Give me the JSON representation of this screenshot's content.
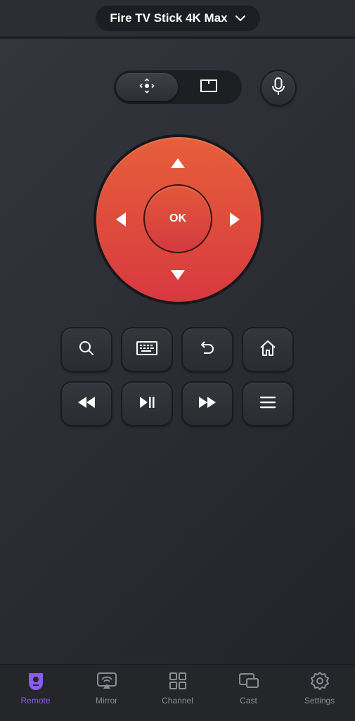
{
  "header": {
    "device_name": "Fire TV Stick 4K Max",
    "dropdown_icon": "chevron-down-icon"
  },
  "mode_toggle": {
    "options": [
      {
        "name": "dpad-mode",
        "icon": "dpad-icon",
        "active": true
      },
      {
        "name": "touchpad-mode",
        "icon": "touchpad-icon",
        "active": false
      }
    ]
  },
  "mic": {
    "icon": "microphone-icon"
  },
  "dpad": {
    "ok_label": "OK",
    "color_top": "#e65f3a",
    "color_bottom": "#d8393f"
  },
  "keys": [
    {
      "name": "search-button",
      "icon": "search-icon"
    },
    {
      "name": "keyboard-button",
      "icon": "keyboard-icon"
    },
    {
      "name": "back-button",
      "icon": "back-icon"
    },
    {
      "name": "home-button",
      "icon": "home-icon"
    },
    {
      "name": "rewind-button",
      "icon": "rewind-icon"
    },
    {
      "name": "play-pause-button",
      "icon": "play-pause-icon"
    },
    {
      "name": "fast-forward-button",
      "icon": "fast-forward-icon"
    },
    {
      "name": "menu-button",
      "icon": "menu-icon"
    }
  ],
  "bottom_nav": {
    "accent_color": "#8a5cf0",
    "items": [
      {
        "label": "Remote",
        "icon": "remote-icon",
        "active": true
      },
      {
        "label": "Mirror",
        "icon": "mirror-icon",
        "active": false
      },
      {
        "label": "Channel",
        "icon": "channel-grid-icon",
        "active": false
      },
      {
        "label": "Cast",
        "icon": "cast-icon",
        "active": false
      },
      {
        "label": "Settings",
        "icon": "gear-icon",
        "active": false
      }
    ]
  }
}
